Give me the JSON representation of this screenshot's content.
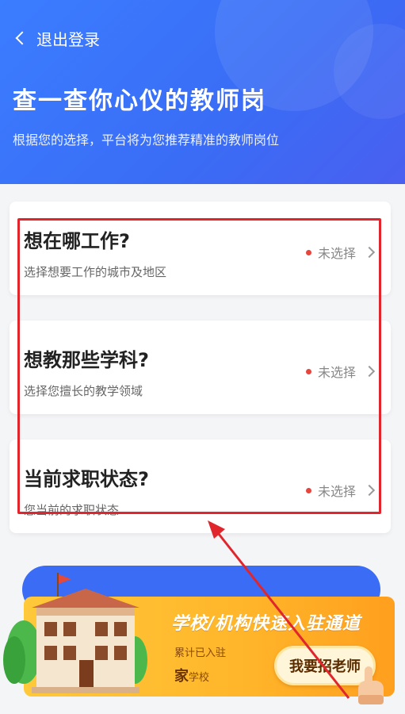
{
  "header": {
    "back_label": "退出登录",
    "title": "查一查你心仪的教师岗",
    "subtitle": "根据您的选择，平台将为您推荐精准的教师岗位"
  },
  "cards": [
    {
      "question": "想在哪工作?",
      "hint": "选择想要工作的城市及地区",
      "status": "未选择"
    },
    {
      "question": "想教那些学科?",
      "hint": "选择您擅长的教学领域",
      "status": "未选择"
    },
    {
      "question": "当前求职状态?",
      "hint": "您当前的求职状态",
      "status": "未选择"
    }
  ],
  "banner": {
    "tagline": "学校/机构快速入驻通道",
    "count_label": "累计已入驻",
    "count_unit_big": "家",
    "count_unit_small": "学校",
    "hire_button": "我要招老师"
  },
  "colors": {
    "header_blue": "#3a6cf5",
    "highlight_red": "#e0262c",
    "banner_orange": "#ffb52a",
    "status_dot": "#e8453c"
  }
}
